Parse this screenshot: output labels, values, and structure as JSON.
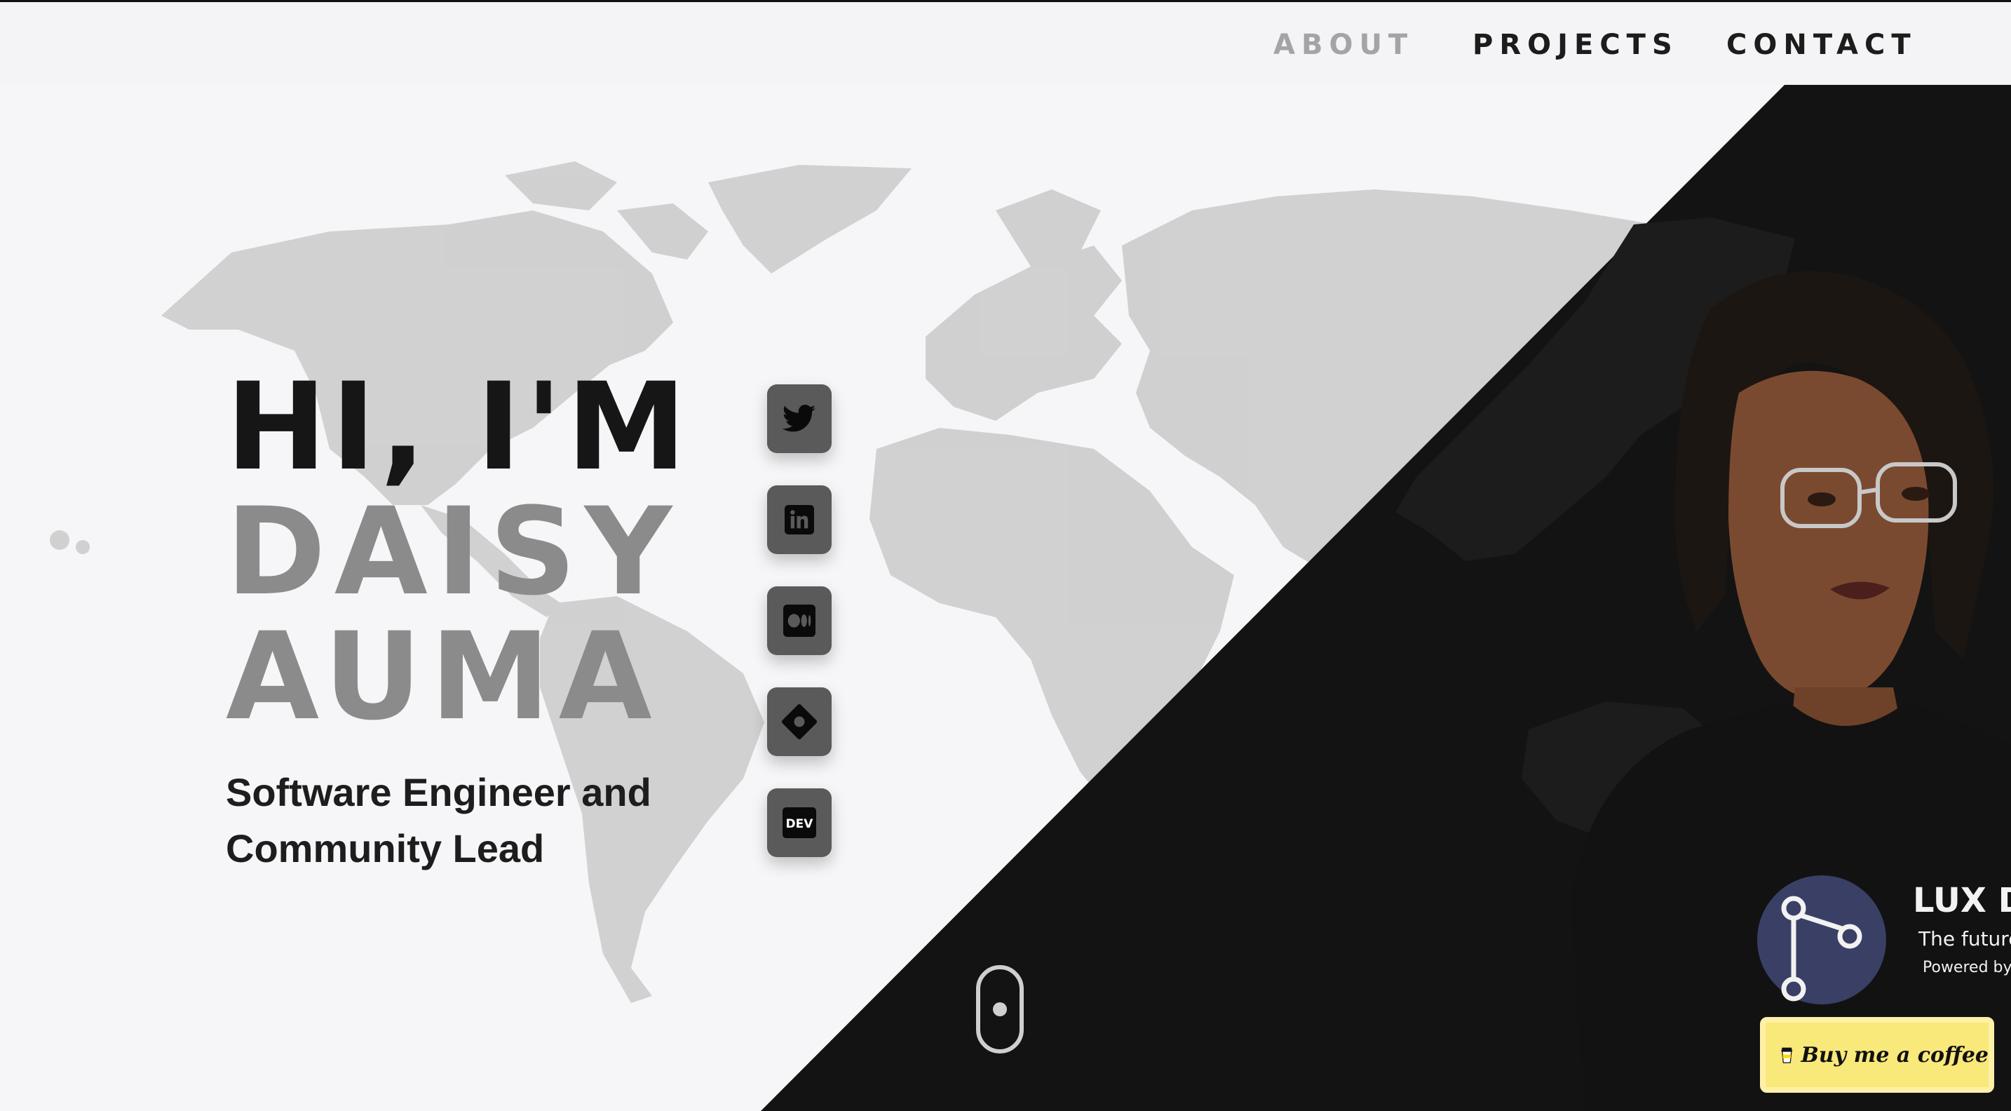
{
  "nav": {
    "links": [
      {
        "label": "ABOUT",
        "active": false
      },
      {
        "label": "PROJECTS",
        "active": true
      },
      {
        "label": "CONTACT",
        "active": true
      }
    ]
  },
  "hero": {
    "greeting": "HI, I'M",
    "first_name": "DAISY",
    "last_name": "AUMA",
    "subtitle_line1": "Software Engineer and",
    "subtitle_line2": "Community Lead"
  },
  "social": [
    {
      "icon": "twitter-icon"
    },
    {
      "icon": "linkedin-icon"
    },
    {
      "icon": "medium-icon"
    },
    {
      "icon": "hashnode-icon"
    },
    {
      "icon": "dev-icon",
      "label": "DEV"
    }
  ],
  "portrait": {
    "shirt_text_1": "LUX D",
    "shirt_text_2": "The future",
    "shirt_text_3": "Powered by"
  },
  "coffee": {
    "label": "Buy me a coffee"
  },
  "colors": {
    "background": "#f6f6f8",
    "dark_panel": "#131313",
    "name_gray": "#8b8b8b",
    "coffee_yellow": "#f9e87a"
  }
}
